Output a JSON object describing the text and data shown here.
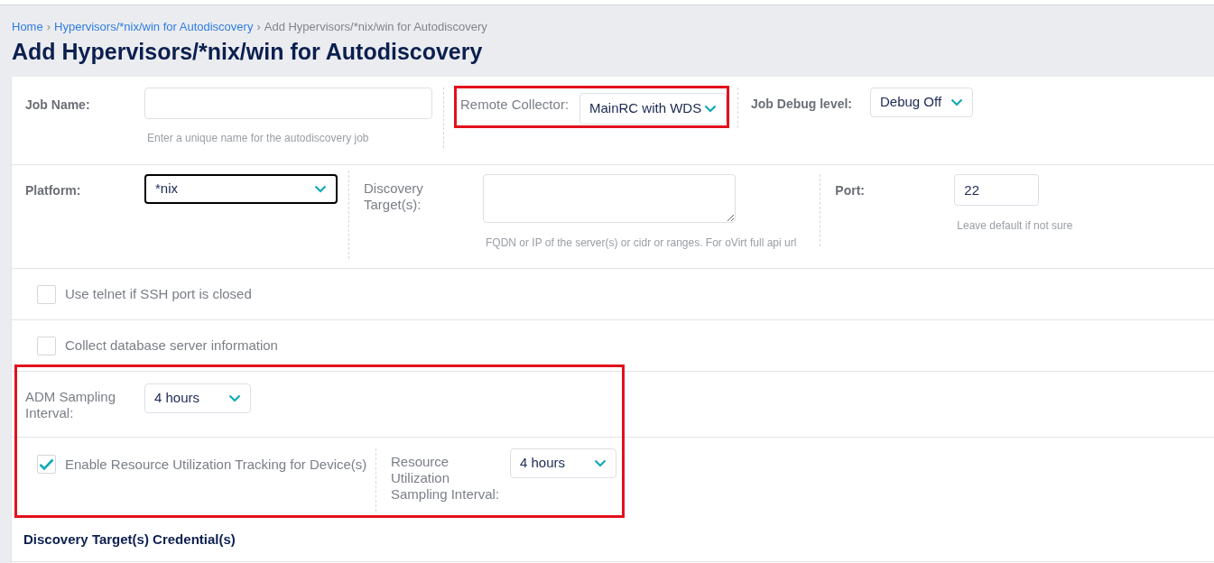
{
  "breadcrumb": {
    "separator": "›",
    "items": [
      {
        "label": "Home",
        "link": true
      },
      {
        "label": "Hypervisors/*nix/win for Autodiscovery",
        "link": true
      },
      {
        "label": "Add Hypervisors/*nix/win for Autodiscovery",
        "link": false
      }
    ]
  },
  "title": "Add Hypervisors/*nix/win for Autodiscovery",
  "job_row": {
    "job_name": {
      "label": "Job Name:",
      "hint": "Enter a unique name for the autodiscovery job"
    },
    "remote_collector": {
      "label": "Remote Collector:",
      "value": "MainRC with WDS",
      "highlighted": true
    },
    "debug_level": {
      "label": "Job Debug level:",
      "value": "Debug Off"
    }
  },
  "platform_row": {
    "platform": {
      "label": "Platform:",
      "value": "*nix",
      "focused": true
    },
    "discovery_targets": {
      "label": "Discovery Target(s):",
      "hint": "FQDN or IP of the server(s) or cidr or ranges. For oVirt full api url"
    },
    "port": {
      "label": "Port:",
      "value": "22",
      "hint": "Leave default if not sure"
    }
  },
  "options": [
    {
      "label": "Use telnet if SSH port is closed",
      "checked": false
    },
    {
      "label": "Collect database server information",
      "checked": false
    }
  ],
  "sampling_group": {
    "highlighted": true,
    "adm": {
      "label": "ADM Sampling Interval:",
      "value": "4 hours"
    },
    "tracking": {
      "label": "Enable Resource Utilization Tracking for Device(s)",
      "checked": true
    },
    "resource_interval": {
      "label": "Resource Utilization Sampling Interval:",
      "value": "4 hours"
    }
  },
  "credentials_heading": "Discovery Target(s) Credential(s)"
}
